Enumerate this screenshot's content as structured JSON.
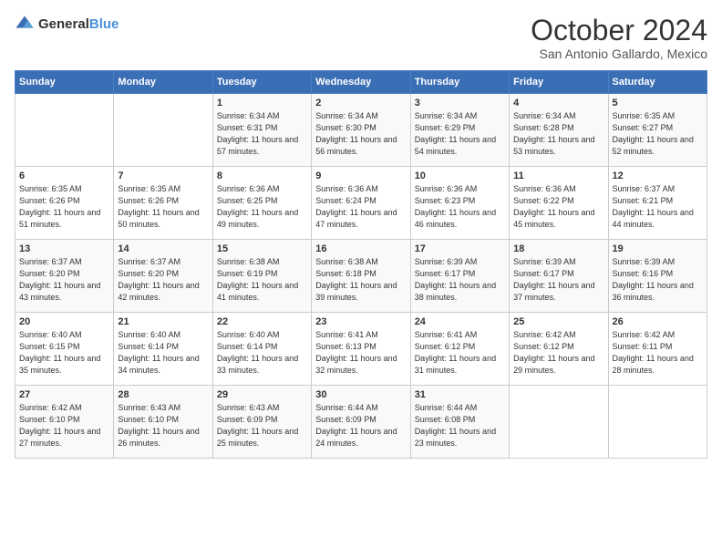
{
  "header": {
    "logo_general": "General",
    "logo_blue": "Blue",
    "title": "October 2024",
    "location": "San Antonio Gallardo, Mexico"
  },
  "weekdays": [
    "Sunday",
    "Monday",
    "Tuesday",
    "Wednesday",
    "Thursday",
    "Friday",
    "Saturday"
  ],
  "weeks": [
    [
      {
        "day": "",
        "info": ""
      },
      {
        "day": "",
        "info": ""
      },
      {
        "day": "1",
        "info": "Sunrise: 6:34 AM\nSunset: 6:31 PM\nDaylight: 11 hours and 57 minutes."
      },
      {
        "day": "2",
        "info": "Sunrise: 6:34 AM\nSunset: 6:30 PM\nDaylight: 11 hours and 56 minutes."
      },
      {
        "day": "3",
        "info": "Sunrise: 6:34 AM\nSunset: 6:29 PM\nDaylight: 11 hours and 54 minutes."
      },
      {
        "day": "4",
        "info": "Sunrise: 6:34 AM\nSunset: 6:28 PM\nDaylight: 11 hours and 53 minutes."
      },
      {
        "day": "5",
        "info": "Sunrise: 6:35 AM\nSunset: 6:27 PM\nDaylight: 11 hours and 52 minutes."
      }
    ],
    [
      {
        "day": "6",
        "info": "Sunrise: 6:35 AM\nSunset: 6:26 PM\nDaylight: 11 hours and 51 minutes."
      },
      {
        "day": "7",
        "info": "Sunrise: 6:35 AM\nSunset: 6:26 PM\nDaylight: 11 hours and 50 minutes."
      },
      {
        "day": "8",
        "info": "Sunrise: 6:36 AM\nSunset: 6:25 PM\nDaylight: 11 hours and 49 minutes."
      },
      {
        "day": "9",
        "info": "Sunrise: 6:36 AM\nSunset: 6:24 PM\nDaylight: 11 hours and 47 minutes."
      },
      {
        "day": "10",
        "info": "Sunrise: 6:36 AM\nSunset: 6:23 PM\nDaylight: 11 hours and 46 minutes."
      },
      {
        "day": "11",
        "info": "Sunrise: 6:36 AM\nSunset: 6:22 PM\nDaylight: 11 hours and 45 minutes."
      },
      {
        "day": "12",
        "info": "Sunrise: 6:37 AM\nSunset: 6:21 PM\nDaylight: 11 hours and 44 minutes."
      }
    ],
    [
      {
        "day": "13",
        "info": "Sunrise: 6:37 AM\nSunset: 6:20 PM\nDaylight: 11 hours and 43 minutes."
      },
      {
        "day": "14",
        "info": "Sunrise: 6:37 AM\nSunset: 6:20 PM\nDaylight: 11 hours and 42 minutes."
      },
      {
        "day": "15",
        "info": "Sunrise: 6:38 AM\nSunset: 6:19 PM\nDaylight: 11 hours and 41 minutes."
      },
      {
        "day": "16",
        "info": "Sunrise: 6:38 AM\nSunset: 6:18 PM\nDaylight: 11 hours and 39 minutes."
      },
      {
        "day": "17",
        "info": "Sunrise: 6:39 AM\nSunset: 6:17 PM\nDaylight: 11 hours and 38 minutes."
      },
      {
        "day": "18",
        "info": "Sunrise: 6:39 AM\nSunset: 6:17 PM\nDaylight: 11 hours and 37 minutes."
      },
      {
        "day": "19",
        "info": "Sunrise: 6:39 AM\nSunset: 6:16 PM\nDaylight: 11 hours and 36 minutes."
      }
    ],
    [
      {
        "day": "20",
        "info": "Sunrise: 6:40 AM\nSunset: 6:15 PM\nDaylight: 11 hours and 35 minutes."
      },
      {
        "day": "21",
        "info": "Sunrise: 6:40 AM\nSunset: 6:14 PM\nDaylight: 11 hours and 34 minutes."
      },
      {
        "day": "22",
        "info": "Sunrise: 6:40 AM\nSunset: 6:14 PM\nDaylight: 11 hours and 33 minutes."
      },
      {
        "day": "23",
        "info": "Sunrise: 6:41 AM\nSunset: 6:13 PM\nDaylight: 11 hours and 32 minutes."
      },
      {
        "day": "24",
        "info": "Sunrise: 6:41 AM\nSunset: 6:12 PM\nDaylight: 11 hours and 31 minutes."
      },
      {
        "day": "25",
        "info": "Sunrise: 6:42 AM\nSunset: 6:12 PM\nDaylight: 11 hours and 29 minutes."
      },
      {
        "day": "26",
        "info": "Sunrise: 6:42 AM\nSunset: 6:11 PM\nDaylight: 11 hours and 28 minutes."
      }
    ],
    [
      {
        "day": "27",
        "info": "Sunrise: 6:42 AM\nSunset: 6:10 PM\nDaylight: 11 hours and 27 minutes."
      },
      {
        "day": "28",
        "info": "Sunrise: 6:43 AM\nSunset: 6:10 PM\nDaylight: 11 hours and 26 minutes."
      },
      {
        "day": "29",
        "info": "Sunrise: 6:43 AM\nSunset: 6:09 PM\nDaylight: 11 hours and 25 minutes."
      },
      {
        "day": "30",
        "info": "Sunrise: 6:44 AM\nSunset: 6:09 PM\nDaylight: 11 hours and 24 minutes."
      },
      {
        "day": "31",
        "info": "Sunrise: 6:44 AM\nSunset: 6:08 PM\nDaylight: 11 hours and 23 minutes."
      },
      {
        "day": "",
        "info": ""
      },
      {
        "day": "",
        "info": ""
      }
    ]
  ]
}
